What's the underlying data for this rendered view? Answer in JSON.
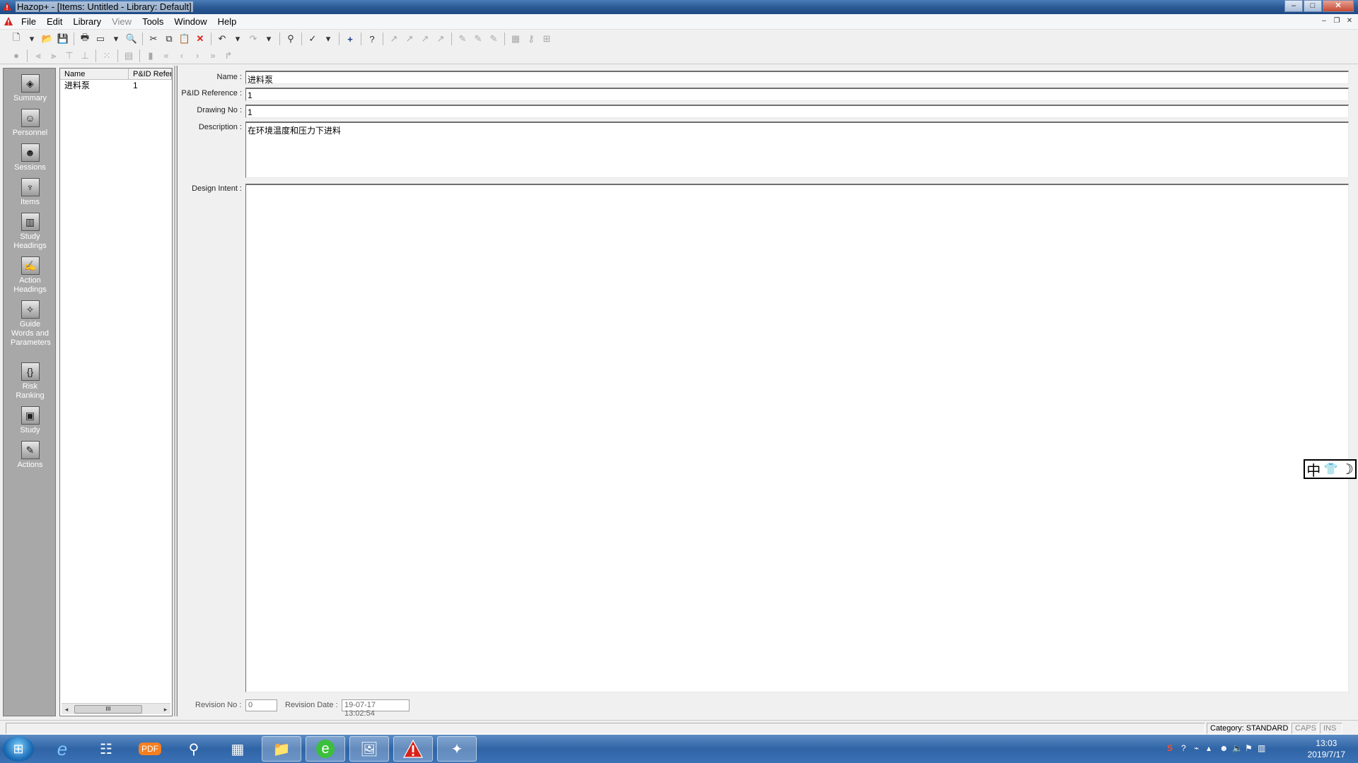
{
  "window": {
    "title": "Hazop+ - [Items: Untitled - Library: Default]",
    "buttons": {
      "minimize": "–",
      "maximize": "□",
      "close": "✕"
    }
  },
  "menu": {
    "items": [
      "File",
      "Edit",
      "Library",
      "View",
      "Tools",
      "Window",
      "Help"
    ],
    "mdi": {
      "minimize": "–",
      "restore": "❐",
      "close": "✕"
    }
  },
  "nav": {
    "items": [
      {
        "label": "Summary",
        "icon": "summary-icon"
      },
      {
        "label": "Personnel",
        "icon": "personnel-icon"
      },
      {
        "label": "Sessions",
        "icon": "sessions-icon"
      },
      {
        "label": "Items",
        "icon": "items-icon"
      },
      {
        "label": "Study Headings",
        "icon": "study-headings-icon"
      },
      {
        "label": "Action Headings",
        "icon": "action-headings-icon"
      },
      {
        "label": "Guide Words and Parameters",
        "icon": "guide-words-icon"
      },
      {
        "label": "Risk Ranking",
        "icon": "risk-ranking-icon"
      },
      {
        "label": "Study",
        "icon": "study-icon"
      },
      {
        "label": "Actions",
        "icon": "actions-icon"
      }
    ]
  },
  "list": {
    "columns": [
      "Name",
      "P&ID Refer"
    ],
    "rows": [
      {
        "name": "进料泵",
        "pid": "1"
      }
    ],
    "scroll_thumb": "III"
  },
  "form": {
    "name_label": "Name :",
    "name_value": "进料泵",
    "pid_label": "P&ID Reference :",
    "pid_value": "1",
    "drawing_label": "Drawing No :",
    "drawing_value": "1",
    "description_label": "Description :",
    "description_value": "在环境温度和压力下进料",
    "design_intent_label": "Design Intent :",
    "design_intent_value": "",
    "revision_no_label": "Revision No :",
    "revision_no_value": "0",
    "revision_date_label": "Revision Date :",
    "revision_date_value": "19-07-17 13:02:54"
  },
  "ime": {
    "chars": [
      "中",
      "👕",
      "☽"
    ]
  },
  "status": {
    "category": "Category: STANDARD",
    "caps": "CAPS",
    "ins": "INS"
  },
  "clock": {
    "time": "13:03",
    "date": "2019/7/17"
  },
  "colors": {
    "nav_bg": "#a8a8a8",
    "taskbar": "#2f64a6",
    "title_bar": "#2c5a94"
  }
}
